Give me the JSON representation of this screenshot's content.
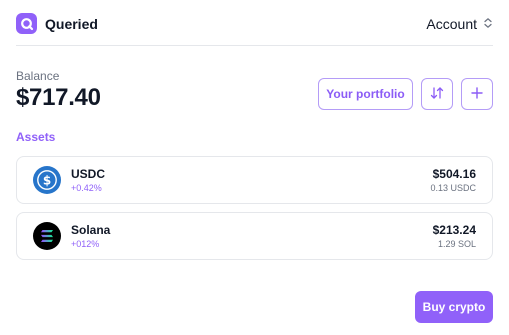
{
  "header": {
    "brand_name": "Queried",
    "account_label": "Account",
    "brand_color": "#9061f9"
  },
  "balance": {
    "label": "Balance",
    "value": "$717.40"
  },
  "actions": {
    "portfolio_label": "Your portfolio",
    "swap_icon": "arrows-up-down-icon",
    "add_icon": "plus-icon"
  },
  "assets": {
    "title": "Assets",
    "items": [
      {
        "name": "USDC",
        "change": "+0.42%",
        "usd_value": "$504.16",
        "amount": "0.13 USDC",
        "icon": "usdc-icon",
        "icon_color": "#2775ca"
      },
      {
        "name": "Solana",
        "change": "+012%",
        "usd_value": "$213.24",
        "amount": "1.29 SOL",
        "icon": "solana-icon",
        "icon_color": "#000000"
      }
    ]
  },
  "buy_button": {
    "label": "Buy crypto"
  }
}
